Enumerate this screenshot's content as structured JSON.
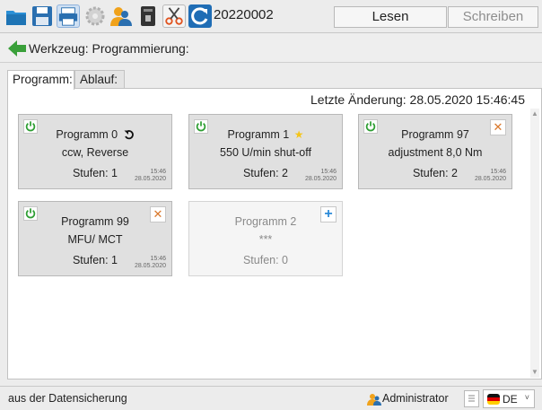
{
  "toolbar": {
    "icons": [
      "folder-icon",
      "save-icon",
      "print-icon",
      "settings-icon",
      "users-icon",
      "archive-icon",
      "cut-icon",
      "refresh-icon"
    ],
    "document_id": "20220002",
    "read_label": "Lesen",
    "write_label": "Schreiben"
  },
  "tool": {
    "back_icon": "back-arrow-icon",
    "title": "Werkzeug: Programmierung:"
  },
  "tabs": [
    {
      "label": "Programm:",
      "active": true
    },
    {
      "label": "Ablauf:",
      "active": false
    }
  ],
  "content": {
    "last_change": "Letzte Änderung: 28.05.2020 15:46:45"
  },
  "programs": [
    {
      "name": "Programm 0",
      "badge": "rotate-ccw-icon",
      "description": "ccw, Reverse",
      "steps": "Stufen: 1",
      "time": "15:46",
      "date": "28.05.2020",
      "corner": "none"
    },
    {
      "name": "Programm 1",
      "badge": "star-icon",
      "description": "550 U/min shut-off",
      "steps": "Stufen: 2",
      "time": "15:46",
      "date": "28.05.2020",
      "corner": "none"
    },
    {
      "name": "Programm 97",
      "badge": "none",
      "description": "adjustment 8,0 Nm",
      "steps": "Stufen: 2",
      "time": "15:46",
      "date": "28.05.2020",
      "corner": "delete"
    },
    {
      "name": "Programm 99",
      "badge": "none",
      "description": "MFU/ MCT",
      "steps": "Stufen: 1",
      "time": "15:46",
      "date": "28.05.2020",
      "corner": "delete"
    },
    {
      "name": "Programm 2",
      "badge": "none",
      "description": "***",
      "steps": "Stufen: 0",
      "time": "",
      "date": "",
      "corner": "add"
    }
  ],
  "status": {
    "message": "aus der Datensicherung",
    "user": "Administrator",
    "language": "DE"
  },
  "colors": {
    "power_green": "#2e9e33",
    "delete_orange": "#d9772a",
    "add_blue": "#2c8ad8",
    "star_yellow": "#f5c518"
  }
}
